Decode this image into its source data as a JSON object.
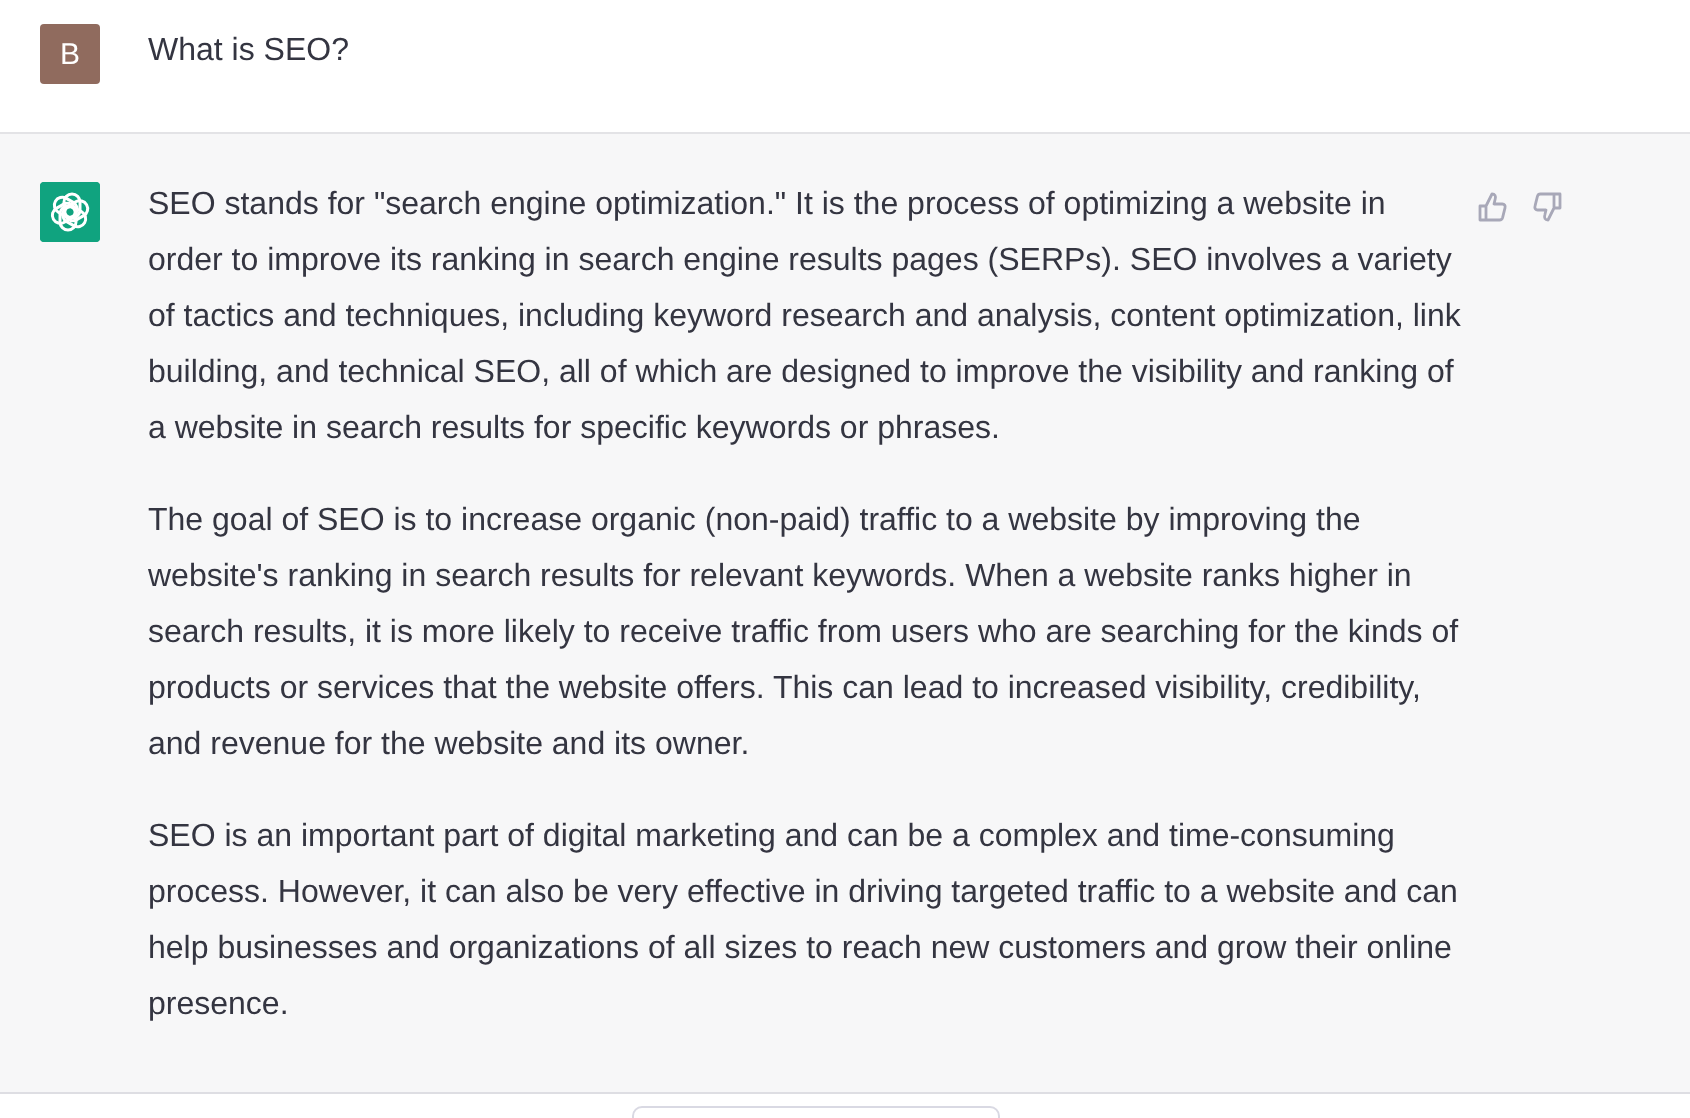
{
  "user_message": {
    "avatar_letter": "B",
    "text": "What is SEO?"
  },
  "assistant_message": {
    "paragraphs": [
      "SEO stands for \"search engine optimization.\" It is the process of optimizing a website in order to improve its ranking in search engine results pages (SERPs). SEO involves a variety of tactics and techniques, including keyword research and analysis, content optimization, link building, and technical SEO, all of which are designed to improve the visibility and ranking of a website in search results for specific keywords or phrases.",
      "The goal of SEO is to increase organic (non-paid) traffic to a website by improving the website's ranking in search results for relevant keywords. When a website ranks higher in search results, it is more likely to receive traffic from users who are searching for the kinds of products or services that the website offers. This can lead to increased visibility, credibility, and revenue for the website and its owner.",
      "SEO is an important part of digital marketing and can be a complex and time-consuming process. However, it can also be very effective in driving targeted traffic to a website and can help businesses and organizations of all sizes to reach new customers and grow their online presence."
    ],
    "feedback": [
      {
        "kind": "thumbs-up"
      },
      {
        "kind": "thumbs-down"
      }
    ]
  }
}
